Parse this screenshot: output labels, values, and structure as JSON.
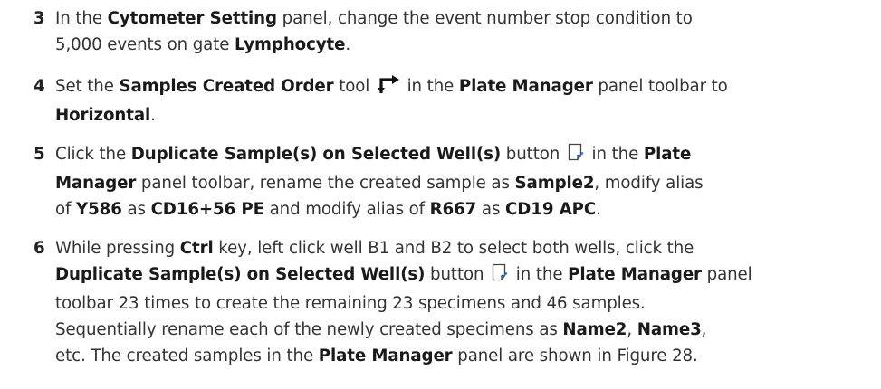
{
  "steps": [
    {
      "number": "3",
      "lines": [
        [
          {
            "t": "In the "
          },
          {
            "t": "Cytometer Setting",
            "b": true
          },
          {
            "t": " panel, change the event number stop condition to"
          }
        ],
        [
          {
            "t": "5,000 events on gate "
          },
          {
            "t": "Lymphocyte",
            "b": true
          },
          {
            "t": "."
          }
        ]
      ]
    },
    {
      "number": "4",
      "lines": [
        [
          {
            "t": "Set the "
          },
          {
            "t": "Samples Created Order",
            "b": true
          },
          {
            "t": " tool "
          },
          {
            "icon": "samples-created-order-icon"
          },
          {
            "t": " in the "
          },
          {
            "t": "Plate Manager",
            "b": true
          },
          {
            "t": " panel toolbar to"
          }
        ],
        [
          {
            "t": "Horizontal",
            "b": true
          },
          {
            "t": "."
          }
        ]
      ]
    },
    {
      "number": "5",
      "lines": [
        [
          {
            "t": "Click the "
          },
          {
            "t": "Duplicate Sample(s) on Selected Well(s)",
            "b": true
          },
          {
            "t": " button "
          },
          {
            "icon": "duplicate-sample-icon"
          },
          {
            "t": " in the "
          },
          {
            "t": "Plate",
            "b": true
          }
        ],
        [
          {
            "t": "Manager",
            "b": true
          },
          {
            "t": " panel toolbar, rename the created sample as "
          },
          {
            "t": "Sample2",
            "b": true
          },
          {
            "t": ", modify alias"
          }
        ],
        [
          {
            "t": "of "
          },
          {
            "t": "Y586",
            "b": true
          },
          {
            "t": " as "
          },
          {
            "t": "CD16+56 PE",
            "b": true
          },
          {
            "t": " and modify alias of "
          },
          {
            "t": "R667",
            "b": true
          },
          {
            "t": " as "
          },
          {
            "t": "CD19 APC",
            "b": true
          },
          {
            "t": "."
          }
        ]
      ]
    },
    {
      "number": "6",
      "lines": [
        [
          {
            "t": "While pressing "
          },
          {
            "t": "Ctrl",
            "b": true
          },
          {
            "t": " key, left click well B1 and B2 to select both wells, click the"
          }
        ],
        [
          {
            "t": "Duplicate Sample(s) on Selected Well(s)",
            "b": true
          },
          {
            "t": " button "
          },
          {
            "icon": "duplicate-sample-icon"
          },
          {
            "t": " in the "
          },
          {
            "t": "Plate Manager",
            "b": true
          },
          {
            "t": " panel"
          }
        ],
        [
          {
            "t": "toolbar 23 times to create the remaining 23 specimens and 46 samples."
          }
        ],
        [
          {
            "t": "Sequentially rename each of the newly created specimens as "
          },
          {
            "t": "Name2",
            "b": true
          },
          {
            "t": ", "
          },
          {
            "t": "Name3",
            "b": true
          },
          {
            "t": ","
          }
        ],
        [
          {
            "t": "etc. The created samples in the "
          },
          {
            "t": "Plate Manager",
            "b": true
          },
          {
            "t": " panel are shown in Figure 28."
          }
        ]
      ]
    }
  ]
}
